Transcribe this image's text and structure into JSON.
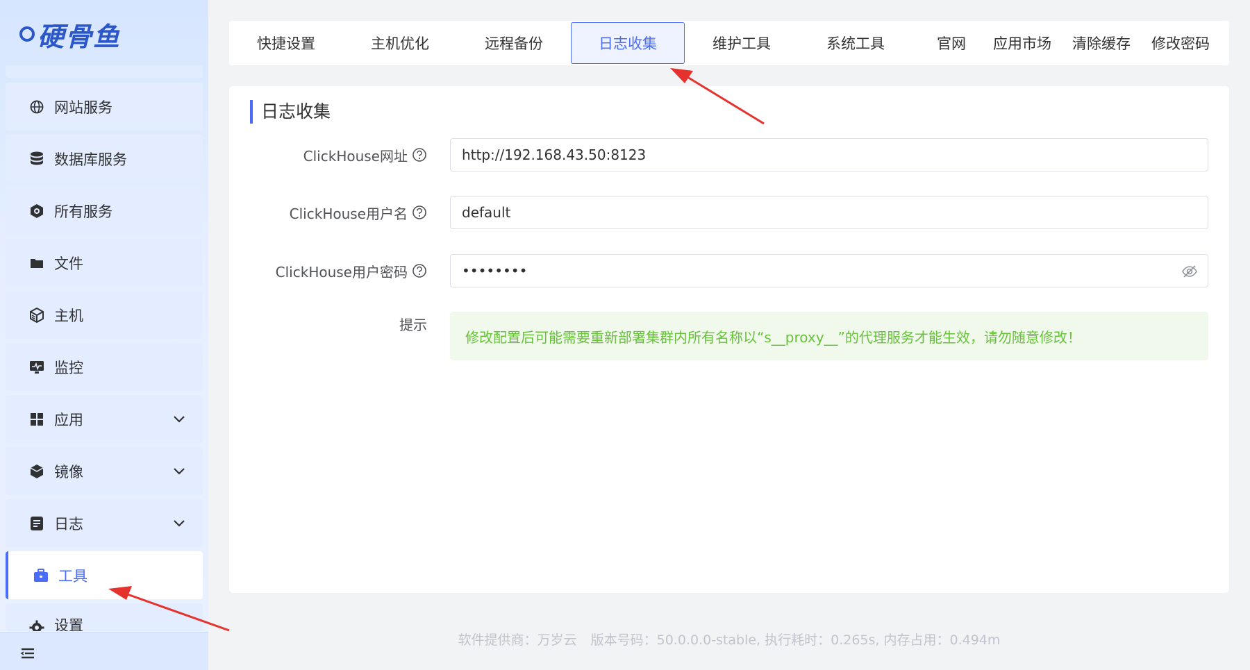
{
  "logo": {
    "text": "硬骨鱼"
  },
  "sidebar": {
    "items": [
      {
        "label": "网站服务",
        "icon": "globe-icon"
      },
      {
        "label": "数据库服务",
        "icon": "database-icon"
      },
      {
        "label": "所有服务",
        "icon": "services-icon"
      },
      {
        "label": "文件",
        "icon": "folder-icon"
      },
      {
        "label": "主机",
        "icon": "server-cube-icon"
      },
      {
        "label": "监控",
        "icon": "monitor-icon"
      },
      {
        "label": "应用",
        "icon": "apps-grid-icon",
        "expandable": true
      },
      {
        "label": "镜像",
        "icon": "image-box-icon",
        "expandable": true
      },
      {
        "label": "日志",
        "icon": "log-doc-icon",
        "expandable": true
      },
      {
        "label": "工具",
        "icon": "toolbox-icon",
        "active": true
      },
      {
        "label": "设置",
        "icon": "gear-icon"
      }
    ]
  },
  "tabs": [
    {
      "label": "快捷设置"
    },
    {
      "label": "主机优化"
    },
    {
      "label": "远程备份"
    },
    {
      "label": "日志收集",
      "active": true
    },
    {
      "label": "维护工具"
    },
    {
      "label": "系统工具"
    },
    {
      "label": "官网"
    },
    {
      "label": "应用市场"
    },
    {
      "label": "清除缓存"
    },
    {
      "label": "修改密码"
    }
  ],
  "card": {
    "title": "日志收集",
    "fields": {
      "url": {
        "label": "ClickHouse网址",
        "value": "http://192.168.43.50:8123"
      },
      "user": {
        "label": "ClickHouse用户名",
        "value": "default"
      },
      "password": {
        "label": "ClickHouse用户密码",
        "value": "••••••••"
      }
    },
    "tip": {
      "label": "提示",
      "text": "修改配置后可能需要重新部署集群内所有名称以“s__proxy__”的代理服务才能生效，请勿随意修改！"
    }
  },
  "footer": {
    "provider": "软件提供商：万岁云",
    "version": "版本号码：50.0.0.0-stable, 执行耗时：0.265s, 内存占用：0.494m"
  },
  "colors": {
    "accent": "#4a6cf7",
    "tip_text": "#67c23a",
    "tip_bg": "#f0f9eb",
    "arrow": "#e5322d"
  }
}
